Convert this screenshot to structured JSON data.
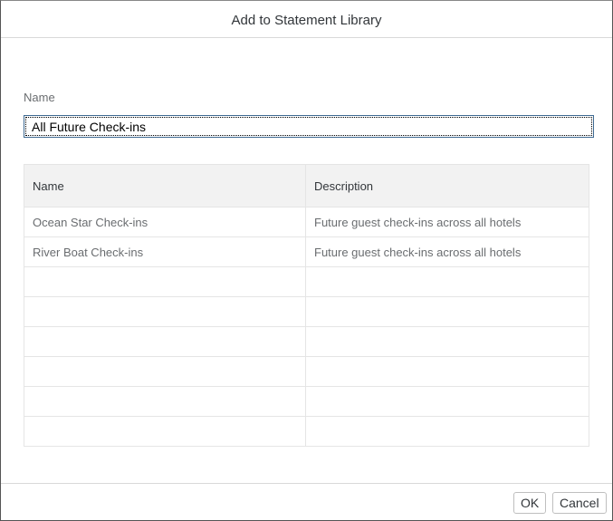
{
  "dialog": {
    "title": "Add to Statement Library",
    "name_label": "Name",
    "name_value": "All Future Check-ins",
    "table": {
      "headers": [
        "Name",
        "Description"
      ],
      "rows": [
        [
          "Ocean Star Check-ins",
          "Future guest check-ins across all hotels"
        ],
        [
          "River Boat Check-ins",
          "Future guest check-ins across all hotels"
        ]
      ]
    },
    "ok_label": "OK",
    "cancel_label": "Cancel"
  }
}
